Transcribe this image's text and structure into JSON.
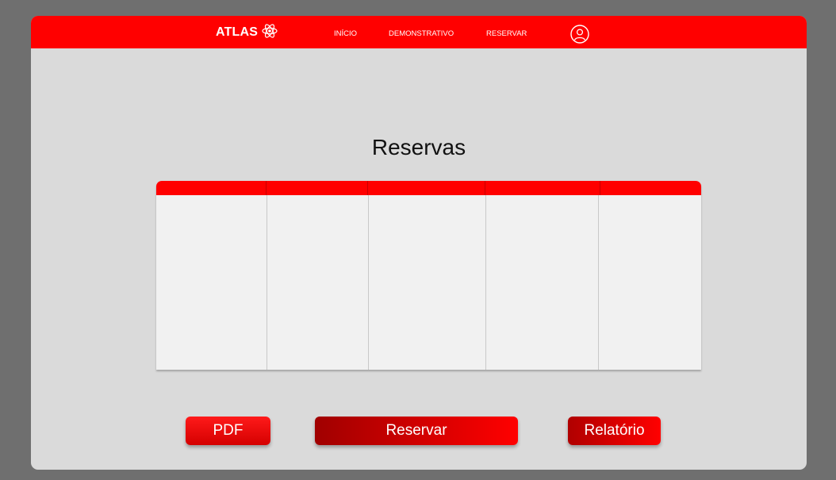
{
  "brand": {
    "name": "ATLAS",
    "icon": "atom-icon"
  },
  "nav": {
    "items": [
      {
        "label": "INÍCIO"
      },
      {
        "label": "DEMONSTRATIVO"
      },
      {
        "label": "RESERVAR"
      }
    ],
    "profile_icon": "user-circle-icon"
  },
  "page": {
    "title": "Reservas"
  },
  "table": {
    "columns": [
      "",
      "",
      "",
      "",
      ""
    ]
  },
  "actions": {
    "pdf": "PDF",
    "reservar": "Reservar",
    "relatorio": "Relatório"
  },
  "colors": {
    "primary": "#ff0000",
    "background": "#dadada",
    "outer_background": "#6f6f6f",
    "table_body": "#f1f1f1"
  }
}
